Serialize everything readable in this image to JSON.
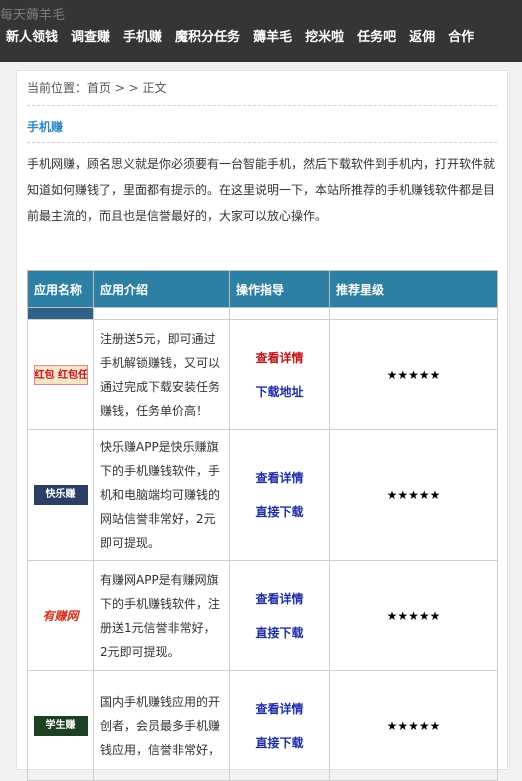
{
  "header": {
    "site_title": "每天薅羊毛",
    "nav": [
      "新人领钱",
      "调查赚",
      "手机赚",
      "魔积分任务",
      "薅羊毛",
      "挖米啦",
      "任务吧",
      "返佣",
      "合作"
    ]
  },
  "breadcrumb": "当前位置：首页 > > 正文",
  "category": "手机赚",
  "intro": "手机网赚，顾名思义就是你必须要有一台智能手机，然后下载软件到手机内，打开软件就知道如何赚钱了，里面都有提示的。在这里说明一下，本站所推荐的手机赚钱软件都是目前最主流的，而且也是信誉最好的，大家可以放心操作。",
  "table": {
    "headers": [
      "应用名称",
      "应用介绍",
      "操作指导",
      "推荐星级"
    ],
    "rows": [
      {
        "logo_text": "红包 红包任务",
        "desc": "注册送5元，即可通过手机解锁赚钱，又可以通过完成下载安装任务赚钱，任务单价高！",
        "op1": "查看详情",
        "op2": "下载地址",
        "stars": "★★★★★"
      },
      {
        "logo_text": "快乐赚",
        "desc": "快乐赚APP是快乐赚旗下的手机赚钱软件，手机和电脑端均可赚钱的网站信誉非常好，2元即可提现。",
        "op1": "查看详情",
        "op2": "直接下载",
        "stars": "★★★★★"
      },
      {
        "logo_text": "有赚网",
        "desc": "有赚网APP是有赚网旗下的手机赚钱软件，注册送1元信誉非常好，2元即可提现。",
        "op1": "查看详情",
        "op2": "直接下载",
        "stars": "★★★★★"
      },
      {
        "logo_text": "学生赚",
        "desc": "国内手机赚钱应用的开创者，会员最多手机赚钱应用，信誉非常好，",
        "op1": "查看详情",
        "op2": "直接下载",
        "stars": "★★★★★"
      }
    ]
  },
  "colors": {
    "topbar": "#353535",
    "table_header": "#2e7fa4",
    "link_red": "#c0141c",
    "link_blue": "#1f2ea8",
    "category": "#2e88c8"
  }
}
